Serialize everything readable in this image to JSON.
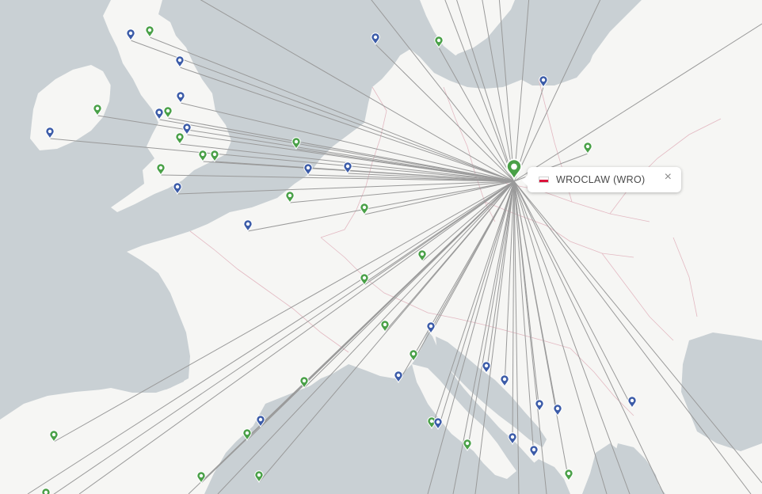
{
  "popup": {
    "airport_label": "WROCLAW (WRO)",
    "close_symbol": "×",
    "flag_icon": "poland-flag-icon"
  },
  "colors": {
    "sea": "#c9d0d4",
    "land": "#f6f6f4",
    "border": "#e3b9c2",
    "route_line": "#9a9a9a",
    "marker_green": "#49a047",
    "marker_blue": "#3b5ba8"
  },
  "markers": {
    "origin": {
      "name": "origin-marker-wroclaw",
      "type": "origin"
    },
    "destinations": [
      {
        "name": "destination-marker-1",
        "type": "green"
      },
      {
        "name": "destination-marker-2",
        "type": "green"
      },
      {
        "name": "destination-marker-3",
        "type": "green"
      },
      {
        "name": "destination-marker-4",
        "type": "green"
      },
      {
        "name": "destination-marker-5",
        "type": "green"
      },
      {
        "name": "destination-marker-6",
        "type": "green"
      },
      {
        "name": "destination-marker-7",
        "type": "green"
      },
      {
        "name": "destination-marker-8",
        "type": "green"
      },
      {
        "name": "destination-marker-9",
        "type": "green"
      },
      {
        "name": "destination-marker-10",
        "type": "green"
      },
      {
        "name": "destination-marker-11",
        "type": "green"
      },
      {
        "name": "destination-marker-12",
        "type": "green"
      },
      {
        "name": "destination-marker-13",
        "type": "green"
      },
      {
        "name": "destination-marker-14",
        "type": "green"
      },
      {
        "name": "destination-marker-15",
        "type": "green"
      },
      {
        "name": "destination-marker-16",
        "type": "green"
      },
      {
        "name": "destination-marker-17",
        "type": "green"
      },
      {
        "name": "destination-marker-18",
        "type": "green"
      },
      {
        "name": "destination-marker-19",
        "type": "green"
      },
      {
        "name": "destination-marker-20",
        "type": "green"
      },
      {
        "name": "destination-marker-21",
        "type": "green"
      },
      {
        "name": "destination-marker-22",
        "type": "green"
      },
      {
        "name": "destination-marker-23",
        "type": "green"
      },
      {
        "name": "destination-marker-24",
        "type": "green"
      },
      {
        "name": "destination-marker-25",
        "type": "green"
      },
      {
        "name": "destination-marker-26",
        "type": "blue"
      },
      {
        "name": "destination-marker-27",
        "type": "blue"
      },
      {
        "name": "destination-marker-28",
        "type": "blue"
      },
      {
        "name": "destination-marker-29",
        "type": "blue"
      },
      {
        "name": "destination-marker-30",
        "type": "blue"
      },
      {
        "name": "destination-marker-31",
        "type": "blue"
      },
      {
        "name": "destination-marker-32",
        "type": "blue"
      },
      {
        "name": "destination-marker-33",
        "type": "blue"
      },
      {
        "name": "destination-marker-34",
        "type": "blue"
      },
      {
        "name": "destination-marker-35",
        "type": "blue"
      },
      {
        "name": "destination-marker-36",
        "type": "blue"
      },
      {
        "name": "destination-marker-37",
        "type": "blue"
      },
      {
        "name": "destination-marker-38",
        "type": "blue"
      },
      {
        "name": "destination-marker-39",
        "type": "blue"
      },
      {
        "name": "destination-marker-40",
        "type": "blue"
      },
      {
        "name": "destination-marker-41",
        "type": "blue"
      },
      {
        "name": "destination-marker-42",
        "type": "blue"
      },
      {
        "name": "destination-marker-43",
        "type": "blue"
      },
      {
        "name": "destination-marker-44",
        "type": "blue"
      },
      {
        "name": "destination-marker-45",
        "type": "blue"
      },
      {
        "name": "destination-marker-46",
        "type": "blue"
      },
      {
        "name": "destination-marker-47",
        "type": "blue"
      },
      {
        "name": "destination-marker-48",
        "type": "blue"
      },
      {
        "name": "destination-marker-49",
        "type": "blue"
      },
      {
        "name": "destination-marker-50",
        "type": "blue"
      }
    ]
  }
}
